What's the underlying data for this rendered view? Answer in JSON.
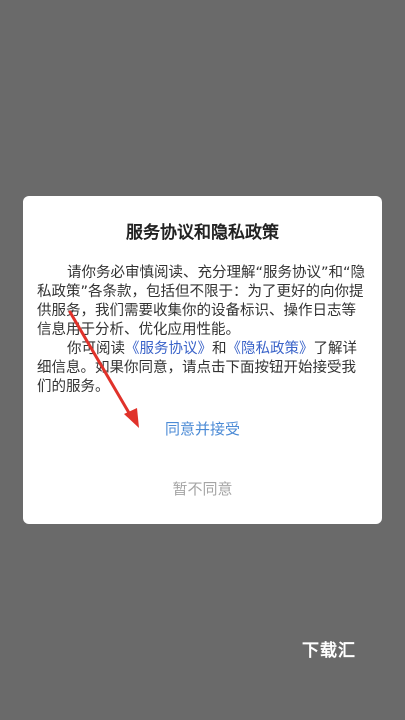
{
  "dialog": {
    "title": "服务协议和隐私政策",
    "para1": "请你务必审慎阅读、充分理解“服务协议”和“隐私政策”各条款，包括但不限于：为了更好的向你提供服务，我们需要收集你的设备标识、操作日志等信息用于分析、优化应用性能。",
    "para2_prefix": "你可阅读",
    "service_link": "《服务协议》",
    "para2_and": "和",
    "privacy_link": "《隐私政策》",
    "para2_suffix": "了解详细信息。如果你同意，请点击下面按钮开始接受我们的服务。",
    "agree_label": "同意并接受",
    "disagree_label": "暂不同意"
  },
  "watermark": "下载汇",
  "colors": {
    "overlay": "#6a6a6a",
    "link": "#3a63c9",
    "agree": "#4c8bd6",
    "disagree": "#a5a5a5",
    "annotation_arrow": "#e0322a"
  },
  "icons": {
    "annotation": "red-arrow-icon"
  }
}
